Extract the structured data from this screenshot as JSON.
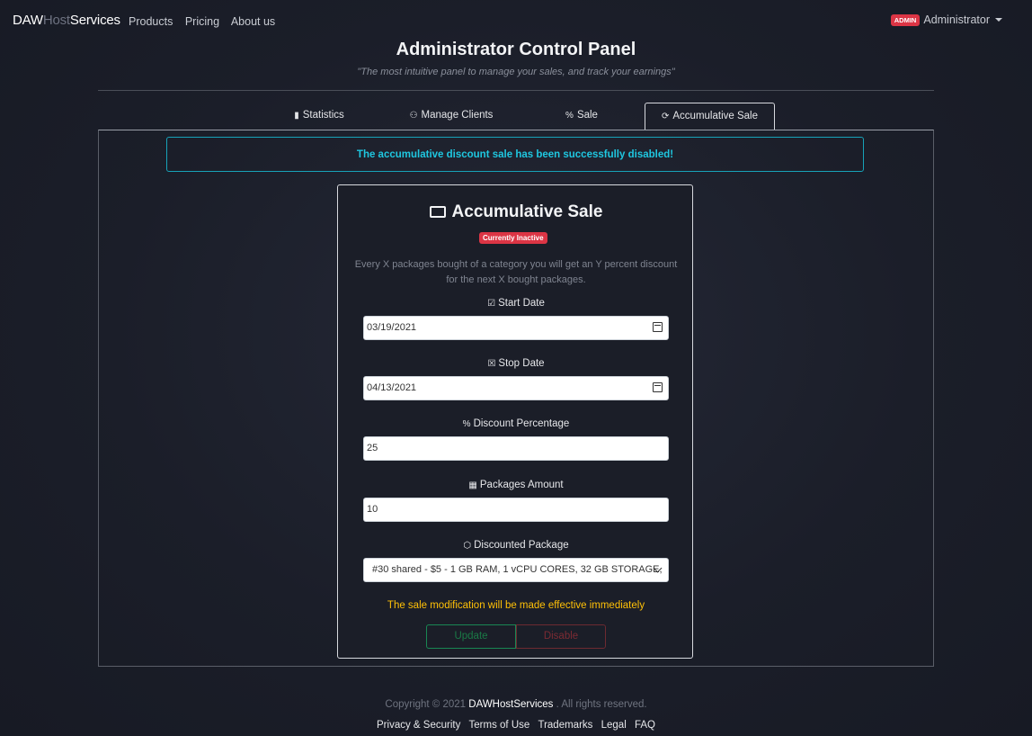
{
  "nav": {
    "brand_part1": "DAW",
    "brand_part2": "Host",
    "brand_part3": "Services",
    "links": [
      "Products",
      "Pricing",
      "About us"
    ],
    "admin_badge": "ADMIN",
    "user_name": "Administrator"
  },
  "header": {
    "title": "Administrator Control Panel",
    "subtitle": "\"The most intuitive panel to manage your sales, and track your earnings\""
  },
  "tabs": [
    {
      "label": "Statistics",
      "icon": "bar-chart-icon"
    },
    {
      "label": "Manage Clients",
      "icon": "users-icon"
    },
    {
      "label": "Sale",
      "icon": "percent-icon"
    },
    {
      "label": "Accumulative Sale",
      "icon": "refresh-icon",
      "active": true
    }
  ],
  "alert": {
    "message": "The accumulative discount sale has been successfully disabled!"
  },
  "card": {
    "title": "Accumulative Sale",
    "status": "Currently Inactive",
    "description_line1": "Every X packages bought of a category you will get an Y percent discount",
    "description_line2": "for the next X bought packages.",
    "start_date_label": "Start Date",
    "start_date_value": "03/19/2021",
    "stop_date_label": "Stop Date",
    "stop_date_value": "04/13/2021",
    "discount_label": "Discount Percentage",
    "discount_value": "25",
    "packages_label": "Packages Amount",
    "packages_value": "10",
    "package_label": "Discounted Package",
    "package_value": "#30 shared - $5 - 1 GB RAM, 1 vCPU CORES, 32 GB STORAGE,",
    "notice": "The sale modification will be made effective immediately",
    "update_label": "Update",
    "disable_label": "Disable"
  },
  "footer": {
    "copyright_prefix": "Copyright © 2021",
    "brand": "DAWHostServices",
    "copyright_suffix": ". All rights reserved.",
    "links": [
      "Privacy & Security",
      "Terms of Use",
      "Trademarks",
      "Legal",
      "FAQ"
    ]
  },
  "colors": {
    "accent_info": "#17a2b8",
    "danger": "#dc3545",
    "success": "#198754",
    "warning": "#ffc107"
  }
}
